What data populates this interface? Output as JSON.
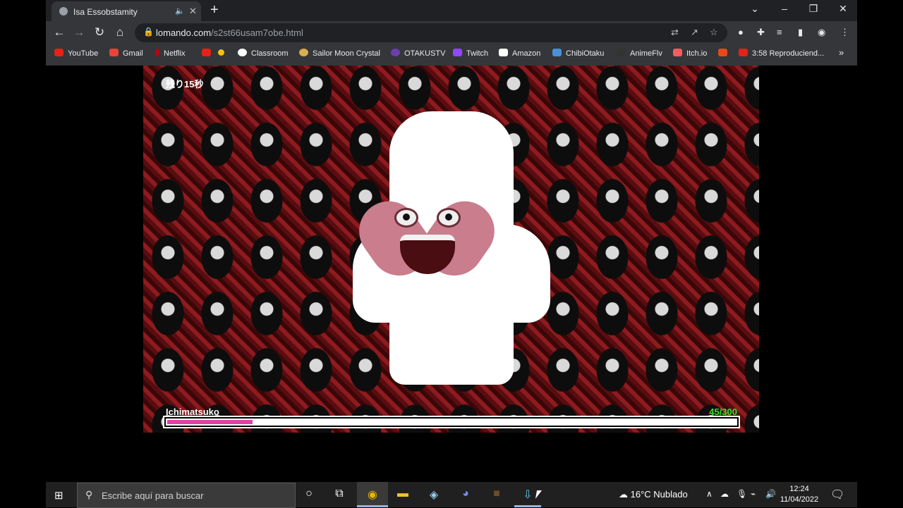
{
  "browser": {
    "tab_title": "Isa Essobstamity",
    "url_host": "lomando.com",
    "url_path": "/s2st66usam7obe.html",
    "bookmarks": [
      "YouTube",
      "Gmail",
      "Netflix",
      "",
      "Classroom",
      "Sailor Moon Crystal",
      "OTAKUSTV",
      "Twitch",
      "Amazon",
      "ChibiOtaku",
      "AnimeFlv",
      "Itch.io",
      "",
      "3:58 Reproduciend..."
    ]
  },
  "game": {
    "timer_text": "残り15秒",
    "enemy_name": "Ichimatsuko",
    "hp_text": "45/300",
    "hp_current": 45,
    "hp_max": 300,
    "hp_color": "#e040a8",
    "counter_color": "#2ee82e"
  },
  "taskbar": {
    "search_placeholder": "Escribe aquí para buscar",
    "weather": "16°C  Nublado",
    "time": "12:24",
    "date": "11/04/2022"
  }
}
